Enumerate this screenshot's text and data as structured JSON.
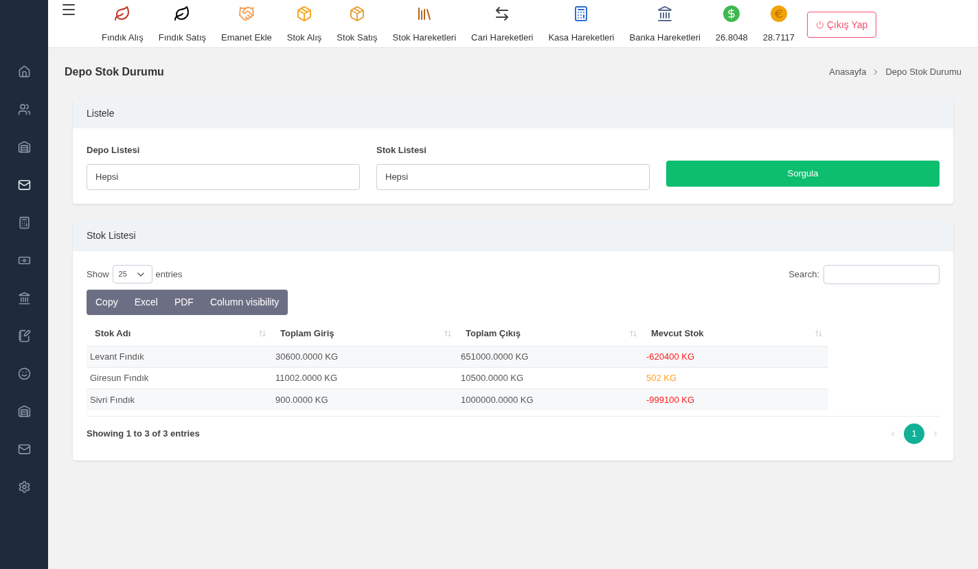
{
  "sidebar": {
    "items": [
      {
        "kind": "home",
        "selected": false
      },
      {
        "kind": "users",
        "selected": false
      },
      {
        "kind": "warehouse",
        "selected": false
      },
      {
        "kind": "mail",
        "selected": true
      },
      {
        "kind": "calculator",
        "selected": false
      },
      {
        "kind": "money",
        "selected": false
      },
      {
        "kind": "bank",
        "selected": false
      },
      {
        "kind": "notebook",
        "selected": false
      },
      {
        "kind": "support",
        "selected": false
      },
      {
        "kind": "warehouse",
        "selected": false
      },
      {
        "kind": "mail",
        "selected": false
      },
      {
        "kind": "settings",
        "selected": false
      }
    ]
  },
  "topbar": {
    "items": [
      {
        "kind": "leaf-red",
        "label": "Fındık Alış"
      },
      {
        "kind": "leaf-black",
        "label": "Fındık Satış"
      },
      {
        "kind": "handshake",
        "label": "Emanet Ekle"
      },
      {
        "kind": "box-in",
        "label": "Stok Alış"
      },
      {
        "kind": "box-out",
        "label": "Stok Satış"
      },
      {
        "kind": "shelves",
        "label": "Stok Hareketleri"
      },
      {
        "kind": "exchange",
        "label": "Cari Hareketleri"
      },
      {
        "kind": "register",
        "label": "Kasa Hareketleri"
      },
      {
        "kind": "bank",
        "label": "Banka Hareketleri"
      },
      {
        "kind": "dollar",
        "label": "26.8048"
      },
      {
        "kind": "euro",
        "label": "28.7117"
      }
    ],
    "logout": "Çıkış Yap"
  },
  "page": {
    "title": "Depo Stok Durumu",
    "breadcrumb": [
      "Anasayfa",
      "Depo Stok Durumu"
    ]
  },
  "filter_card": {
    "title": "Listele",
    "fields": [
      {
        "label": "Depo Listesi",
        "value": "Hepsi"
      },
      {
        "label": "Stok Listesi",
        "value": "Hepsi"
      }
    ],
    "button": "Sorgula"
  },
  "table_card": {
    "title": "Stok Listesi",
    "show_label": "Show",
    "page_size": "25",
    "entries_label": "entries",
    "search_label": "Search:",
    "export_buttons": [
      "Copy",
      "Excel",
      "PDF",
      "Column visibility"
    ],
    "columns": [
      "Stok Adı",
      "Toplam Giriş",
      "Toplam Çıkış",
      "Mevcut Stok"
    ],
    "rows": [
      {
        "cells": [
          "Levant Fındık",
          "30600.0000 KG",
          "651000.0000 KG",
          "-620400 KG"
        ],
        "color": "#ff1a1a"
      },
      {
        "cells": [
          "Giresun Fındık",
          "11002.0000 KG",
          "10500.0000 KG",
          "502 KG"
        ],
        "color": "#ffa126"
      },
      {
        "cells": [
          "Sivri Fındık",
          "900.0000 KG",
          "1000000.0000 KG",
          "-999100 KG"
        ],
        "color": "#ff1a1a"
      }
    ],
    "info": "Showing 1 to 3 of 3 entries",
    "pages": [
      {
        "label": "1",
        "selected": true
      }
    ]
  }
}
